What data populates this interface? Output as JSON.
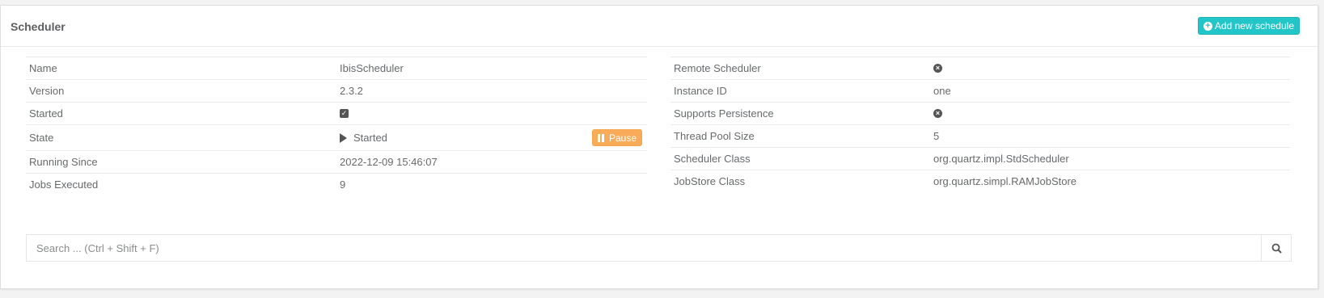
{
  "panel": {
    "title": "Scheduler",
    "add_button_label": "Add new schedule"
  },
  "left_rows": [
    {
      "label": "Name",
      "value": "IbisScheduler"
    },
    {
      "label": "Version",
      "value": "2.3.2"
    },
    {
      "label": "Started",
      "value": "",
      "icon": "check-square-icon"
    },
    {
      "label": "State",
      "value": "Started",
      "icon": "play-icon",
      "action": "Pause"
    },
    {
      "label": "Running Since",
      "value": "2022-12-09 15:46:07"
    },
    {
      "label": "Jobs Executed",
      "value": "9"
    }
  ],
  "right_rows": [
    {
      "label": "Remote Scheduler",
      "value": "",
      "icon": "times-circle-icon"
    },
    {
      "label": "Instance ID",
      "value": "one"
    },
    {
      "label": "Supports Persistence",
      "value": "",
      "icon": "times-circle-icon"
    },
    {
      "label": "Thread Pool Size",
      "value": "5"
    },
    {
      "label": "Scheduler Class",
      "value": "org.quartz.impl.StdScheduler"
    },
    {
      "label": "JobStore Class",
      "value": "org.quartz.simpl.RAMJobStore"
    }
  ],
  "search": {
    "placeholder": "Search ... (Ctrl + Shift + F)",
    "value": ""
  },
  "colors": {
    "add_button": "#23c6c8",
    "pause_button": "#f8ac59"
  }
}
